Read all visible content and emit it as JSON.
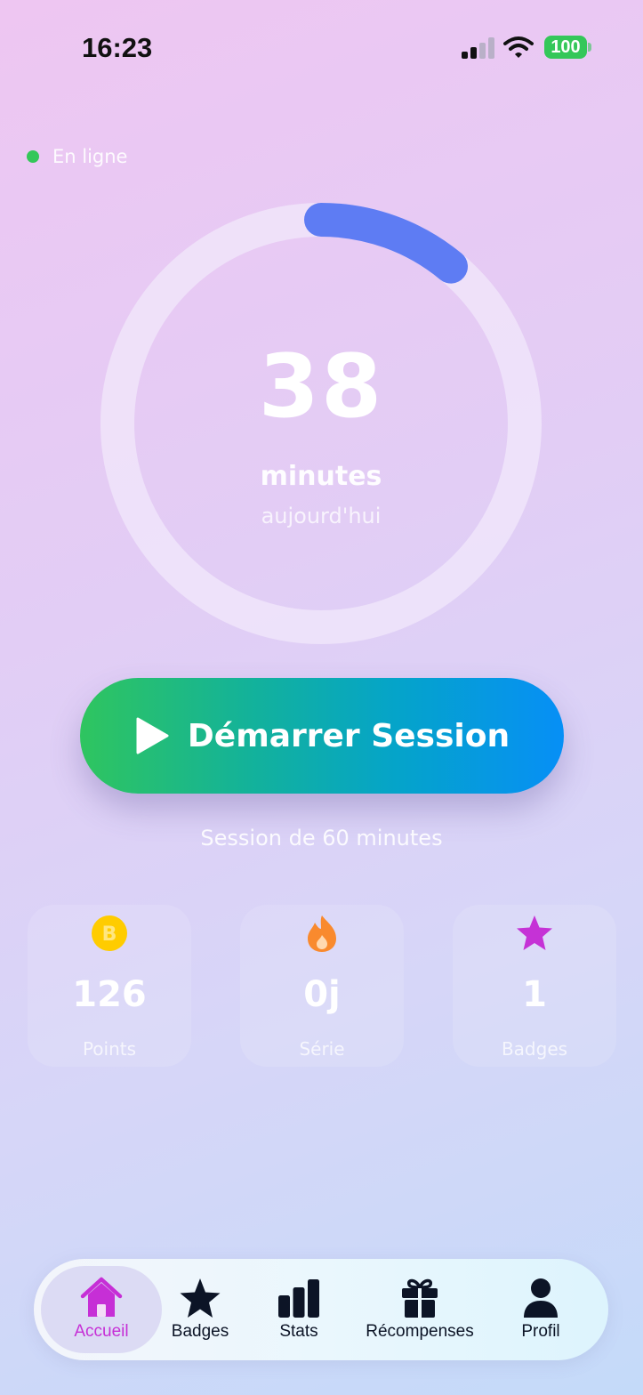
{
  "status_bar": {
    "time": "16:23",
    "battery": "100",
    "icons": [
      "cellular-signal-icon",
      "wifi-icon",
      "battery-icon"
    ]
  },
  "connection": {
    "label": "En ligne",
    "color": "#34c759"
  },
  "daily_progress": {
    "value": "38",
    "unit": "minutes",
    "period": "aujourd'hui",
    "progress_fraction": 0.11,
    "progress_color": "#5e7cf3",
    "track_color": "#f1e8fb"
  },
  "session": {
    "button_label": "Démarrer Session",
    "button_icon": "play-icon",
    "note": "Session de 60 minutes",
    "gradient": [
      "#2fc55f",
      "#068ff6"
    ]
  },
  "stats": [
    {
      "icon": "bitcoin-coin-icon",
      "value": "126",
      "label": "Points",
      "icon_color": "#ffcc00"
    },
    {
      "icon": "flame-icon",
      "value": "0j",
      "label": "Série",
      "icon_color": "#f98a2e"
    },
    {
      "icon": "star-icon",
      "value": "1",
      "label": "Badges",
      "icon_color": "#c532d6"
    }
  ],
  "tabs": [
    {
      "label": "Accueil",
      "icon": "home-icon",
      "active": true
    },
    {
      "label": "Badges",
      "icon": "star-icon",
      "active": false
    },
    {
      "label": "Stats",
      "icon": "bar-chart-icon",
      "active": false
    },
    {
      "label": "Récompenses",
      "icon": "gift-icon",
      "active": false
    },
    {
      "label": "Profil",
      "icon": "person-icon",
      "active": false
    }
  ],
  "colors": {
    "accent": "#c62fd6",
    "tab_text": "#0c1426"
  }
}
